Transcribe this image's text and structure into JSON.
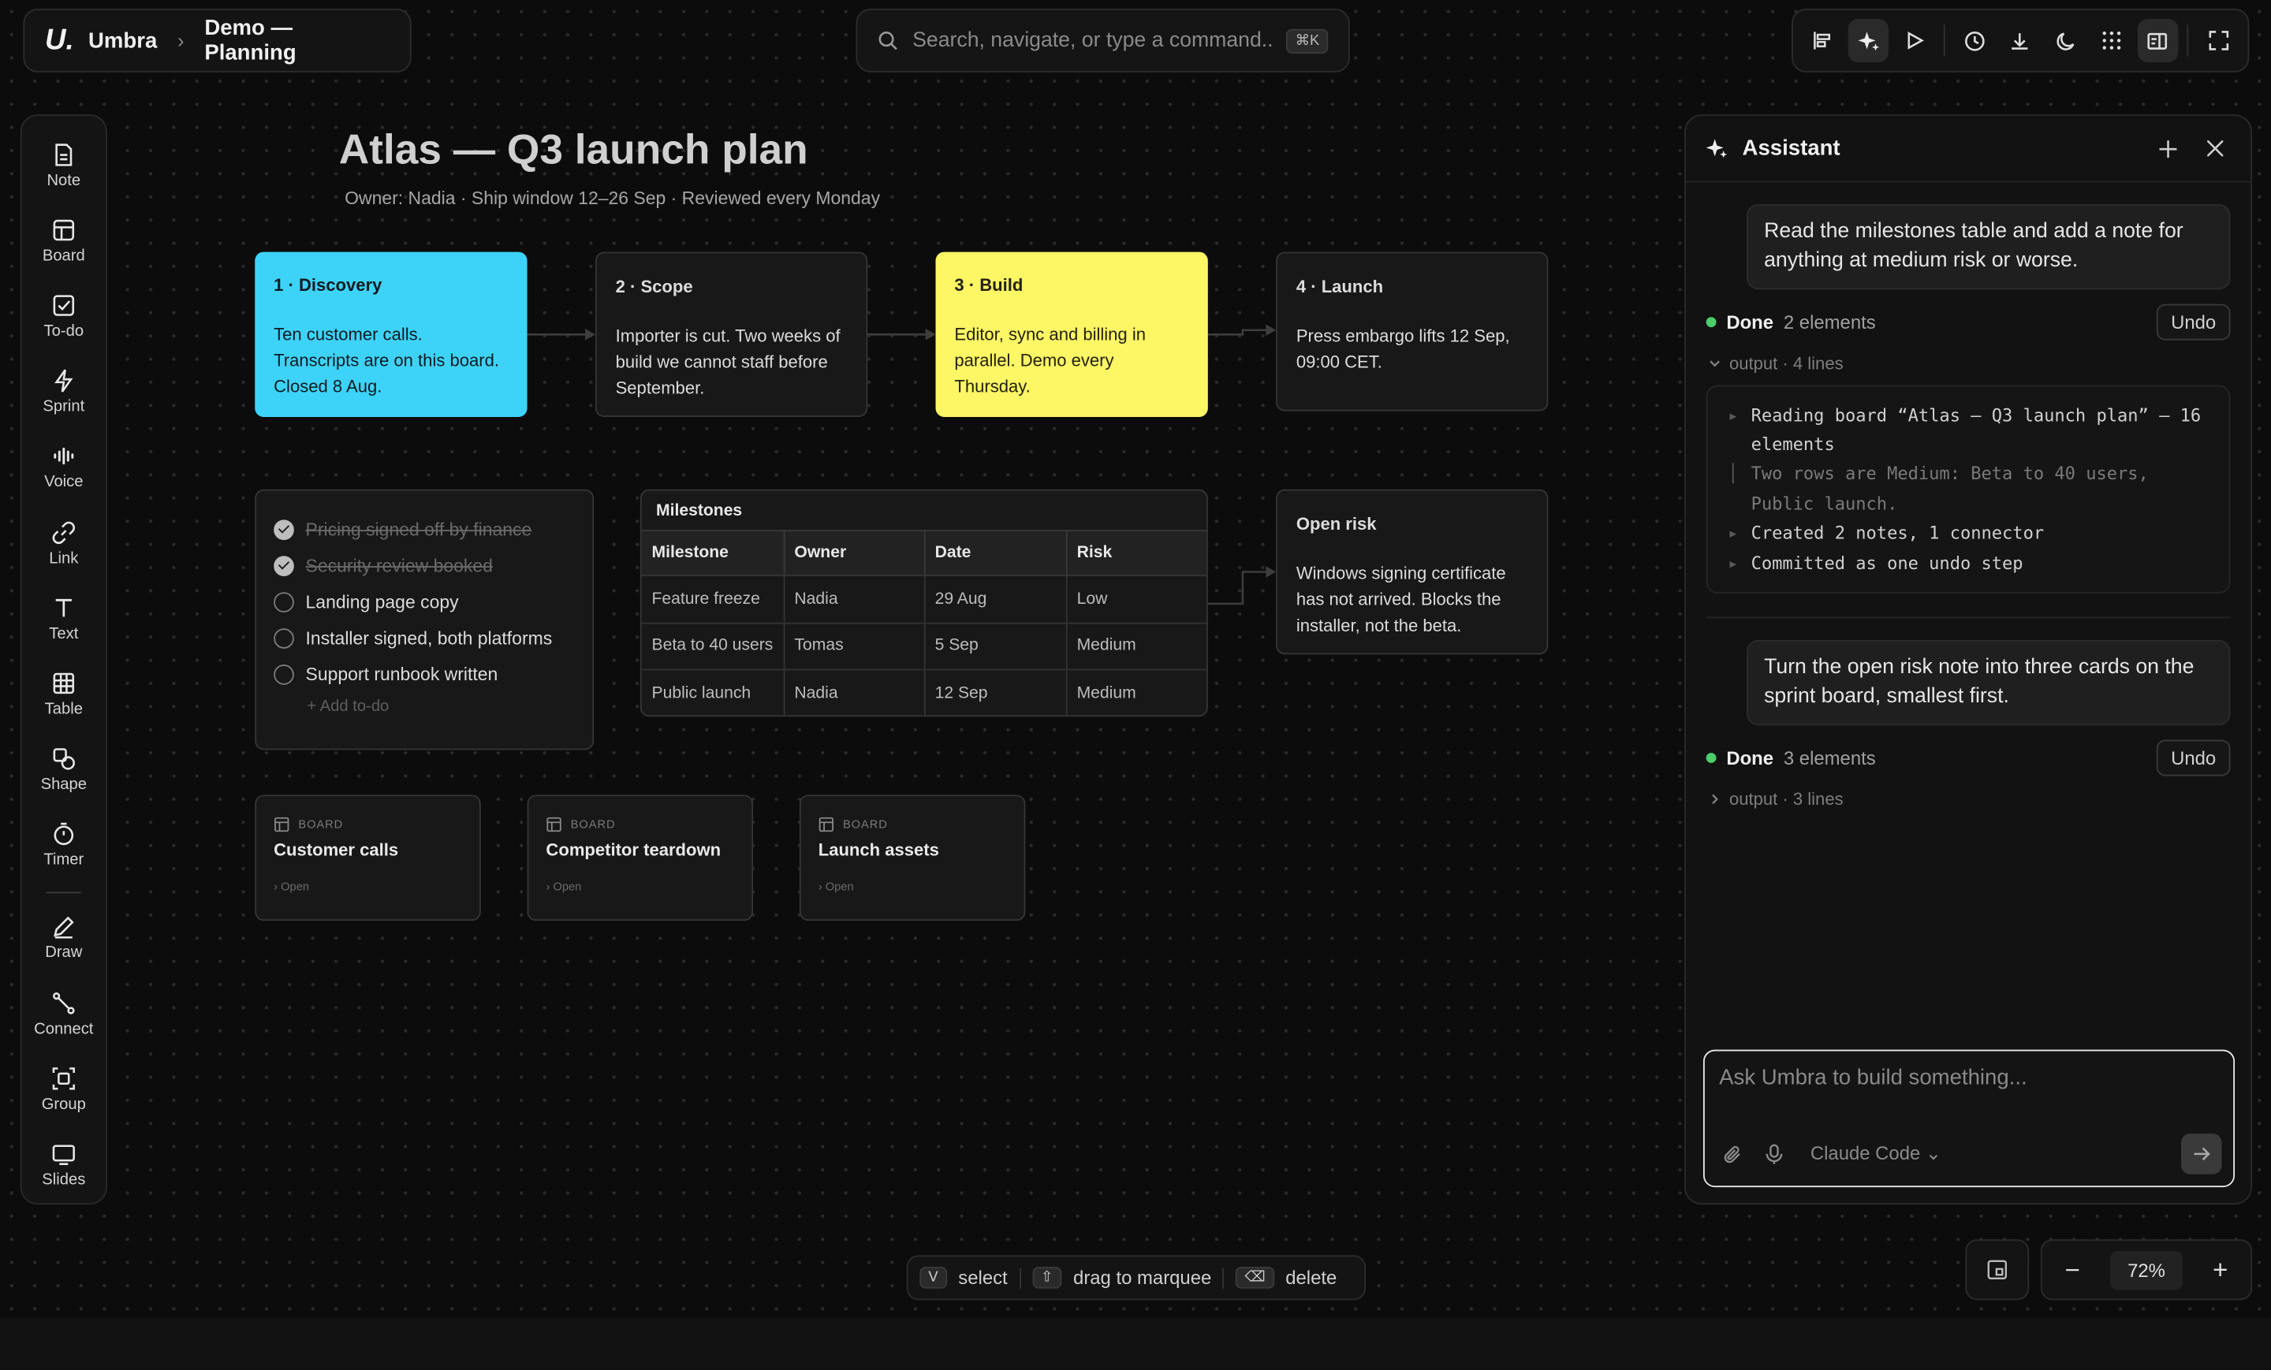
{
  "header": {
    "logo": "U.",
    "app_name": "Umbra",
    "board_name": "Demo — Planning",
    "search_placeholder": "Search, navigate, or type a command...",
    "search_shortcut": "⌘K"
  },
  "toolbar": {
    "buttons": [
      "align-icon",
      "sparkle-icon",
      "play-icon",
      "history-icon",
      "download-icon",
      "moon-icon",
      "grid-icon",
      "panel-icon",
      "fullscreen-icon"
    ],
    "active": [
      "sparkle-icon",
      "panel-icon"
    ]
  },
  "rail": {
    "items": [
      {
        "label": "Note",
        "icon": "note-icon"
      },
      {
        "label": "Board",
        "icon": "board-icon"
      },
      {
        "label": "To-do",
        "icon": "todo-icon"
      },
      {
        "label": "Sprint",
        "icon": "sprint-icon"
      },
      {
        "label": "Voice",
        "icon": "voice-icon"
      },
      {
        "label": "Link",
        "icon": "link-icon"
      },
      {
        "label": "Text",
        "icon": "text-icon"
      },
      {
        "label": "Table",
        "icon": "table-icon"
      },
      {
        "label": "Shape",
        "icon": "shape-icon"
      },
      {
        "label": "Timer",
        "icon": "timer-icon"
      },
      {
        "label": "Draw",
        "icon": "draw-icon"
      },
      {
        "label": "Connect",
        "icon": "connect-icon"
      },
      {
        "label": "Group",
        "icon": "group-icon"
      },
      {
        "label": "Slides",
        "icon": "slides-icon"
      }
    ]
  },
  "board": {
    "title": "Atlas — Q3 launch plan",
    "subtitle": "Owner: Nadia · Ship window 12–26 Sep · Reviewed every Monday",
    "stages": [
      {
        "title": "1 · Discovery",
        "body": "Ten customer calls. Transcripts are on this board. Closed 8 Aug.",
        "color": "#3dd3f9"
      },
      {
        "title": "2 · Scope",
        "body": "Importer is cut. Two weeks of build we cannot staff before September.",
        "color": "#181818"
      },
      {
        "title": "3 · Build",
        "body": "Editor, sync and billing in parallel. Demo every Thursday.",
        "color": "#fdf665"
      },
      {
        "title": "4 · Launch",
        "body": "Press embargo lifts 12 Sep, 09:00 CET.",
        "color": "#181818"
      }
    ],
    "todo": {
      "items": [
        {
          "text": "Pricing signed off by finance",
          "done": true
        },
        {
          "text": "Security review booked",
          "done": true
        },
        {
          "text": "Landing page copy",
          "done": false
        },
        {
          "text": "Installer signed, both platforms",
          "done": false
        },
        {
          "text": "Support runbook written",
          "done": false
        }
      ],
      "add_label": "+ Add to-do"
    },
    "milestones": {
      "title": "Milestones",
      "headers": [
        "Milestone",
        "Owner",
        "Date",
        "Risk"
      ],
      "rows": [
        [
          "Feature freeze",
          "Nadia",
          "29 Aug",
          "Low"
        ],
        [
          "Beta to 40 users",
          "Tomas",
          "5 Sep",
          "Medium"
        ],
        [
          "Public launch",
          "Nadia",
          "12 Sep",
          "Medium"
        ]
      ]
    },
    "risk": {
      "title": "Open risk",
      "body": "Windows signing certificate has not arrived. Blocks the installer, not the beta."
    },
    "subboards": [
      {
        "kind": "BOARD",
        "title": "Customer calls",
        "open": "› Open"
      },
      {
        "kind": "BOARD",
        "title": "Competitor teardown",
        "open": "› Open"
      },
      {
        "kind": "BOARD",
        "title": "Launch assets",
        "open": "› Open"
      }
    ]
  },
  "assistant": {
    "title": "Assistant",
    "messages": [
      {
        "user": "Read the milestones table and add a note for anything at medium risk or worse.",
        "status": "Done",
        "count": "2 elements",
        "undo": "Undo",
        "output_label": "output · 4 lines",
        "expanded": true,
        "output": [
          {
            "mark": "▸",
            "text": "Reading board “Atlas — Q3 launch plan” — 16 elements",
            "sub": false
          },
          {
            "mark": "│",
            "text": "Two rows are Medium: Beta to 40 users, Public launch.",
            "sub": true
          },
          {
            "mark": "▸",
            "text": "Created 2 notes, 1 connector",
            "sub": false
          },
          {
            "mark": "▸",
            "text": "Committed as one undo step",
            "sub": false
          }
        ]
      },
      {
        "user": "Turn the open risk note into three cards on the sprint board, smallest first.",
        "status": "Done",
        "count": "3 elements",
        "undo": "Undo",
        "output_label": "output · 3 lines",
        "expanded": false
      }
    ],
    "composer_placeholder": "Ask Umbra to build something...",
    "model": "Claude Code"
  },
  "hints": [
    {
      "key": "V",
      "label": "select"
    },
    {
      "key": "⇧",
      "label": "drag to marquee"
    },
    {
      "key": "⌫",
      "label": "delete"
    }
  ],
  "zoom": {
    "value": "72%",
    "minus": "−",
    "plus": "+"
  }
}
